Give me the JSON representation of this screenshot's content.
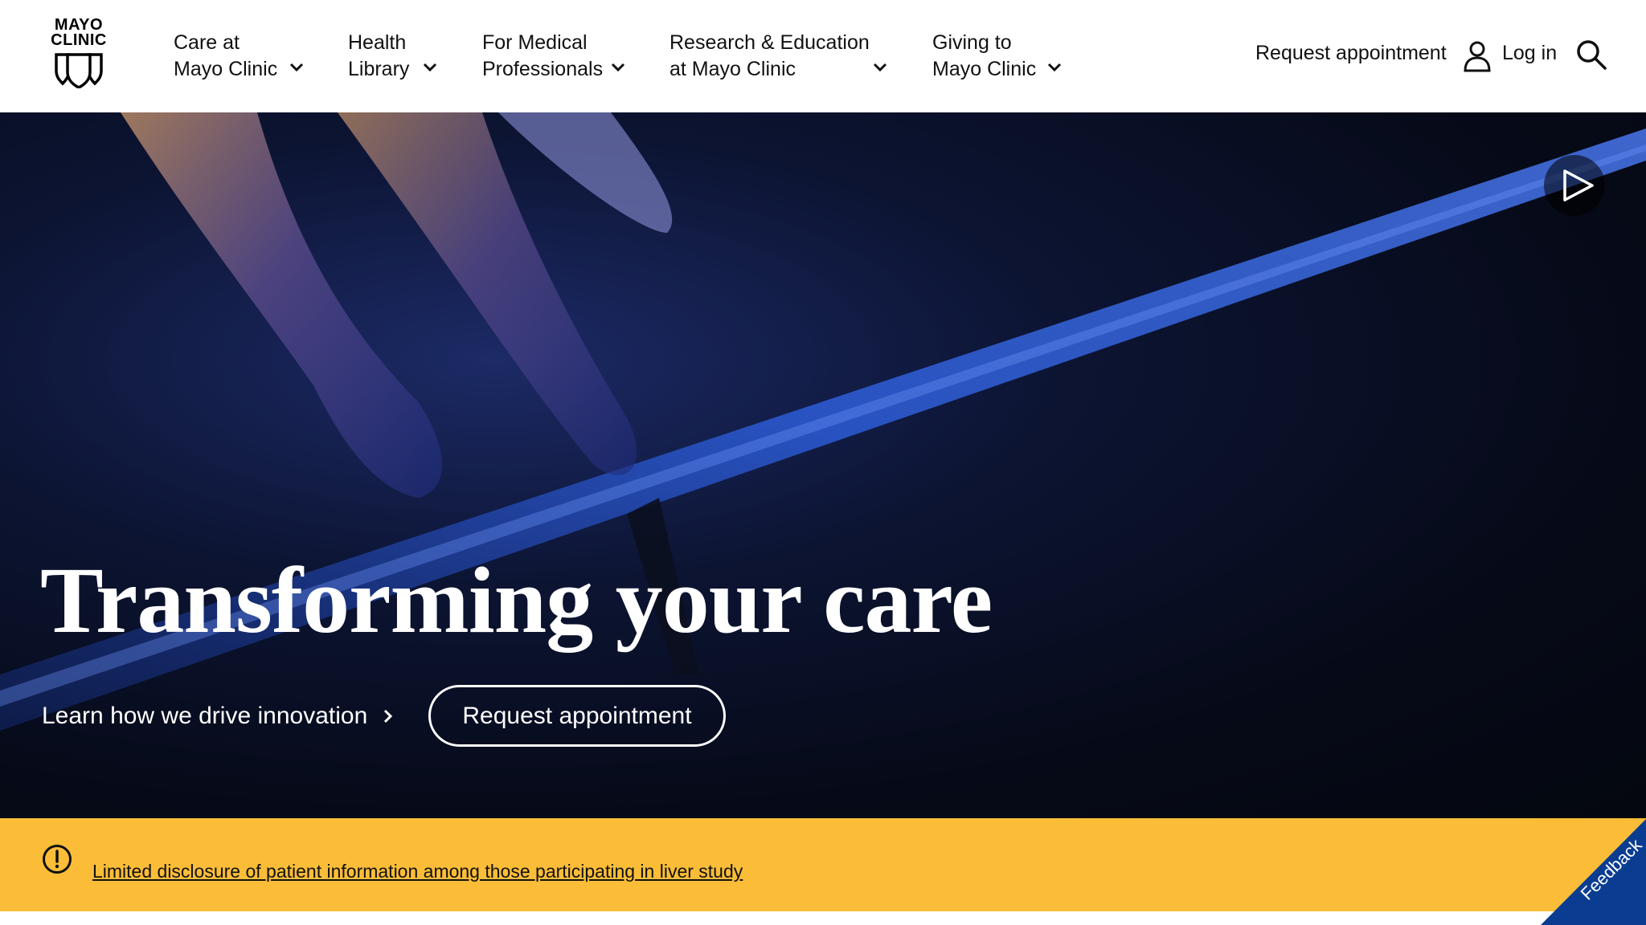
{
  "header": {
    "logo": {
      "line1": "MAYO",
      "line2": "CLINIC"
    },
    "nav": [
      {
        "line1": "Care at",
        "line2": "Mayo Clinic"
      },
      {
        "line1": "Health",
        "line2": "Library"
      },
      {
        "line1": "For Medical",
        "line2": "Professionals"
      },
      {
        "line1": "Research & Education",
        "line2": "at Mayo Clinic"
      },
      {
        "line1": "Giving to",
        "line2": "Mayo Clinic"
      }
    ],
    "request_appointment": "Request appointment",
    "login": "Log in"
  },
  "hero": {
    "title": "Transforming your care",
    "learn_link": "Learn how we drive innovation",
    "appointment_button": "Request appointment"
  },
  "alert": {
    "text": "Limited disclosure of patient information among those participating in liver study"
  },
  "feedback": {
    "label": "Feedback"
  },
  "colors": {
    "alert_bg": "#fbbd38",
    "feedback_bg": "#0a3d91",
    "hero_bg": "#060a18"
  }
}
